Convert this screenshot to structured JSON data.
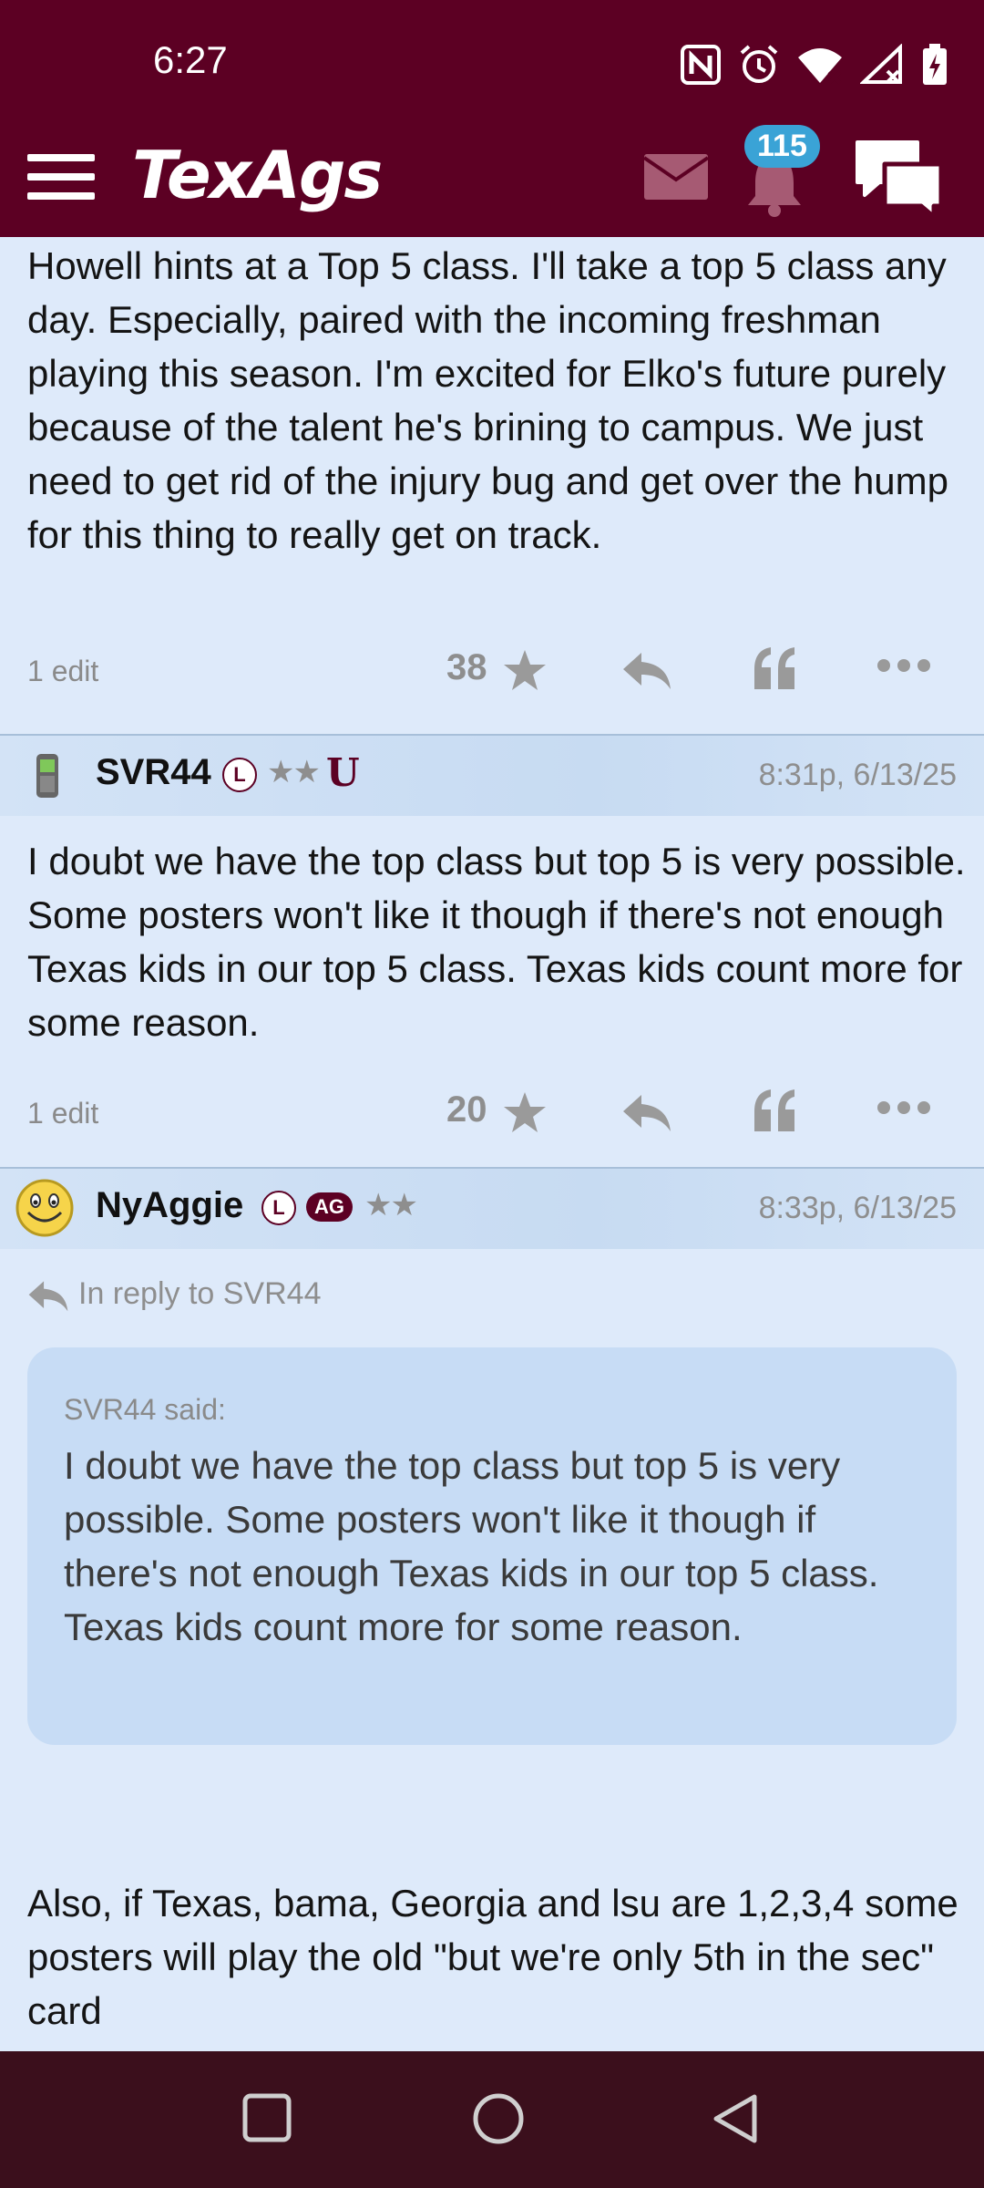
{
  "status_bar": {
    "time": "6:27",
    "icons": [
      "nfc-icon",
      "alarm-icon",
      "wifi-icon",
      "signal-icon",
      "battery-charging-icon"
    ]
  },
  "header": {
    "logo": "TexAgs",
    "notification_count": "115",
    "icons": [
      "menu-icon",
      "mail-icon",
      "bell-icon",
      "chat-icon"
    ]
  },
  "posts": [
    {
      "body": "Howell hints at a Top 5 class. I'll take a top 5 class any day. Especially, paired with the incoming freshman playing this season. I'm excited for Elko's future purely because of the talent he's brining to campus. We just need to get rid of the injury bug and get over the hump for this thing to really get on track.",
      "edit_label": "1 edit",
      "rating": "38"
    },
    {
      "username": "SVR44",
      "badge_l": "L",
      "stars": "★★",
      "timestamp": "8:31p, 6/13/25",
      "body": "I doubt we have the top class but top 5 is very possible. Some posters won't like it though if there's not enough Texas kids in our top 5 class. Texas kids count more for some reason.",
      "edit_label": "1 edit",
      "rating": "20"
    },
    {
      "username": "NyAggie",
      "badge_l": "L",
      "badge_ag": "AG",
      "stars": "★★",
      "timestamp": "8:33p, 6/13/25",
      "in_reply_to": "In reply to SVR44",
      "quote_said": "SVR44 said:",
      "quote_text": "I doubt we have the top class but top 5 is very possible. Some posters won't like it though if there's not enough Texas kids in our top 5 class. Texas kids count more for some reason.",
      "body": "Also, if Texas, bama, Georgia and lsu are 1,2,3,4 some posters will play the old \"but we're only 5th in the sec\" card"
    }
  ],
  "colors": {
    "brand_maroon": "#5c0023",
    "post_bg": "#deeafa",
    "header_bg": "#c7dbf2",
    "badge_blue": "#3aa3d6",
    "nav_bg": "#3b0f1c"
  }
}
